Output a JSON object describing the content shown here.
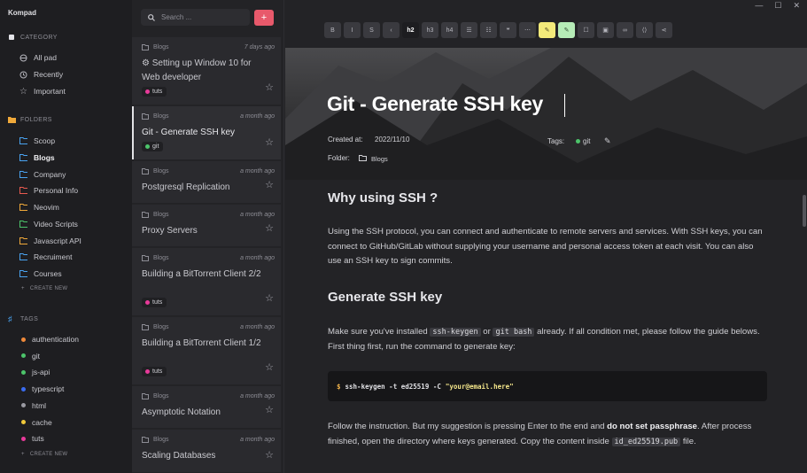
{
  "app": {
    "title": "Kompad"
  },
  "sidebar": {
    "category_heading": "CATEGORY",
    "categories": [
      {
        "label": "All pad"
      },
      {
        "label": "Recently"
      },
      {
        "label": "Important"
      }
    ],
    "folders_heading": "FOLDERS",
    "folders": [
      {
        "label": "Scoop",
        "color": "#4aa3f0"
      },
      {
        "label": "Blogs",
        "color": "#4aa3f0",
        "active": true
      },
      {
        "label": "Company",
        "color": "#4aa3f0"
      },
      {
        "label": "Personal Info",
        "color": "#e85a4f"
      },
      {
        "label": "Neovim",
        "color": "#f0a93a"
      },
      {
        "label": "Video Scripts",
        "color": "#4cc46a"
      },
      {
        "label": "Javascript API",
        "color": "#f0a93a"
      },
      {
        "label": "Recruiment",
        "color": "#4aa3f0"
      },
      {
        "label": "Courses",
        "color": "#4aa3f0"
      }
    ],
    "folders_create": "CREATE NEW",
    "tags_heading": "TAGS",
    "tags": [
      {
        "label": "authentication",
        "color": "#f08a3a"
      },
      {
        "label": "git",
        "color": "#4cc46a"
      },
      {
        "label": "js-api",
        "color": "#4cc46a"
      },
      {
        "label": "typescript",
        "color": "#3a6cf0"
      },
      {
        "label": "html",
        "color": "#9a9aa2"
      },
      {
        "label": "cache",
        "color": "#f0c93a"
      },
      {
        "label": "tuts",
        "color": "#e83a9a"
      }
    ],
    "tags_create": "CREATE NEW"
  },
  "notelist": {
    "search_placeholder": "Search ...",
    "add_label": "+",
    "notes": [
      {
        "category": "Blogs",
        "time": "7 days ago",
        "title": "⚙ Setting up Window 10 for Web developer",
        "tag": "tuts",
        "tag_color": "#e83a9a"
      },
      {
        "category": "Blogs",
        "time": "a month ago",
        "title": "Git - Generate SSH key",
        "tag": "git",
        "tag_color": "#4cc46a",
        "active": true
      },
      {
        "category": "Blogs",
        "time": "a month ago",
        "title": "Postgresql Replication"
      },
      {
        "category": "Blogs",
        "time": "a month ago",
        "title": "Proxy Servers"
      },
      {
        "category": "Blogs",
        "time": "a month ago",
        "title": "Building a BitTorrent Client 2/2",
        "tag": "tuts",
        "tag_color": "#e83a9a"
      },
      {
        "category": "Blogs",
        "time": "a month ago",
        "title": "Building a BitTorrent Client 1/2",
        "tag": "tuts",
        "tag_color": "#e83a9a"
      },
      {
        "category": "Blogs",
        "time": "a month ago",
        "title": "Asymptotic Notation"
      },
      {
        "category": "Blogs",
        "time": "a month ago",
        "title": "Scaling Databases"
      }
    ]
  },
  "toolbar": {
    "buttons": [
      {
        "name": "bold",
        "label": "B"
      },
      {
        "name": "italic",
        "label": "I"
      },
      {
        "name": "strike",
        "label": "S"
      },
      {
        "name": "code",
        "label": "‹"
      },
      {
        "name": "h2",
        "label": "h2",
        "active": true
      },
      {
        "name": "h3",
        "label": "h3"
      },
      {
        "name": "h4",
        "label": "h4"
      },
      {
        "name": "bullet-list",
        "label": "☰"
      },
      {
        "name": "ordered-list",
        "label": "☷"
      },
      {
        "name": "quote",
        "label": "❝"
      },
      {
        "name": "hr",
        "label": "⋯"
      },
      {
        "name": "highlight-yellow",
        "label": "✎",
        "style": "hl-yellow"
      },
      {
        "name": "highlight-green",
        "label": "✎",
        "style": "hl-green"
      },
      {
        "name": "task",
        "label": "☐"
      },
      {
        "name": "image",
        "label": "▣"
      },
      {
        "name": "link",
        "label": "∞"
      },
      {
        "name": "code-block",
        "label": "⟨⟩"
      },
      {
        "name": "share",
        "label": "⋖"
      }
    ]
  },
  "note": {
    "title": "Git - Generate SSH key",
    "created_label": "Created at:",
    "created_value": "2022/11/10",
    "tags_label": "Tags:",
    "tag": "git",
    "tag_color": "#4cc46a",
    "folder_label": "Folder:",
    "folder_value": "Blogs"
  },
  "content": {
    "h_why": "Why using SSH ?",
    "p_why": "Using the SSH protocol, you can connect and authenticate to remote servers and services. With SSH keys, you can connect to GitHub/GitLab without supplying your username and personal access token at each visit. You can also use an SSH key to sign commits.",
    "h_gen": "Generate SSH key",
    "p_gen_1": "Make sure you've installed",
    "code_keygen": "ssh-keygen",
    "p_gen_or": "or",
    "code_gitbash": "git bash",
    "p_gen_2": "already. If all condition met, please follow the guide belows. First thing first, run the command to generate key:",
    "cmd_prompt": "$",
    "cmd_text": "ssh-keygen -t ed25519 -C",
    "cmd_str": "\"your@email.here\"",
    "p_follow_1": "Follow the instruction. But my suggestion is pressing Enter to the end and",
    "p_follow_bold": "do not set passphrase",
    "p_follow_2": ". After process finished, open the directory where keys generated. Copy the content inside",
    "code_pub": "id_ed25519.pub",
    "p_follow_3": "file."
  }
}
